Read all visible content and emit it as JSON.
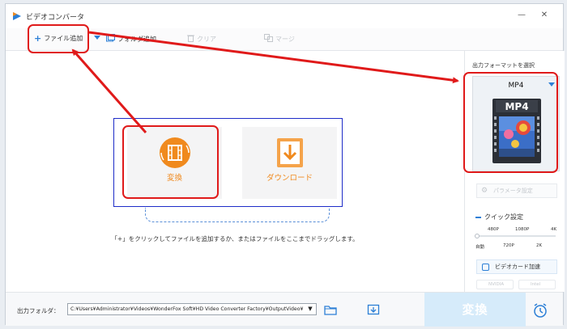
{
  "window": {
    "title": "ビデオコンバータ",
    "minimize_icon": "minimize-icon",
    "close_icon": "close-icon"
  },
  "toolbar": {
    "add_file": "ファイル追加",
    "add_folder": "フォルダ追加",
    "clear": "クリア",
    "merge": "マージ"
  },
  "main": {
    "convert_tile": "変換",
    "download_tile": "ダウンロード",
    "hint": "「+」をクリックしてファイルを追加するか、またはファイルをここまでドラッグします。"
  },
  "right_panel": {
    "title": "出力フォーマットを選択",
    "format": "MP4",
    "format_badge": "MP4",
    "param_button": "パラメータ設定",
    "quick_title": "クイック設定",
    "quality_top": [
      "480P",
      "1080P",
      "4K"
    ],
    "quality_bottom": [
      "自動",
      "720P",
      "2K"
    ],
    "quality_selected": "自動",
    "gpu_button": "ビデオカード加速",
    "gpu_nvidia": "NVIDIA",
    "gpu_intel": "Intel"
  },
  "bottom": {
    "output_label": "出力フォルダ：",
    "output_path": "C:¥Users¥Administrator¥Videos¥WonderFox Soft¥HD Video Converter Factory¥OutputVideo¥",
    "convert_button": "変換"
  },
  "colors": {
    "accent": "#2c7fd6",
    "orange": "#f08a1e",
    "annotation_red": "#e01a1a",
    "dropzone_border": "#1e2cc8"
  }
}
